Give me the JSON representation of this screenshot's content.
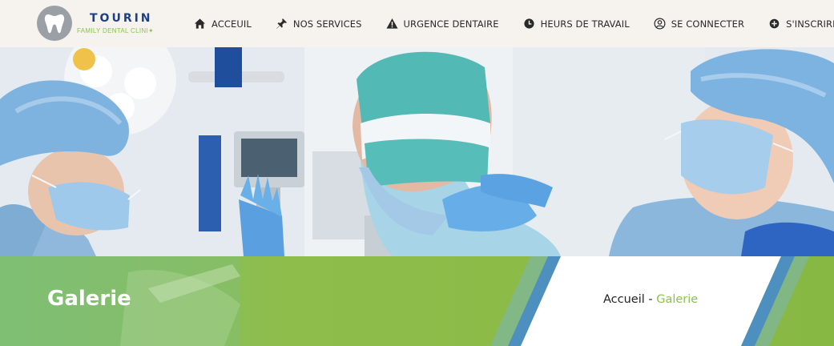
{
  "logo": {
    "name": "TOURIN",
    "tagline": "FAMILY DENTAL CLINI✦"
  },
  "nav": [
    {
      "label": "ACCEUIL",
      "icon": "home-icon"
    },
    {
      "label": "NOS SERVICES",
      "icon": "pin-icon"
    },
    {
      "label": "URGENCE DENTAIRE",
      "icon": "warning-icon"
    },
    {
      "label": "HEURS DE TRAVAIL",
      "icon": "clock-icon"
    },
    {
      "label": "SE CONNECTER",
      "icon": "user-circle-icon"
    },
    {
      "label": "S'INSCRIRE",
      "icon": "plus-circle-icon"
    }
  ],
  "banner": {
    "title": "Galerie",
    "breadcrumb": {
      "home": "Accueil",
      "separator": " - ",
      "current": "Galerie"
    }
  },
  "colors": {
    "header_bg": "#f6f3ee",
    "brand_blue": "#1c3f8a",
    "accent_green": "#8bc34a",
    "banner_blue_stripe": "#4d8fbf"
  }
}
